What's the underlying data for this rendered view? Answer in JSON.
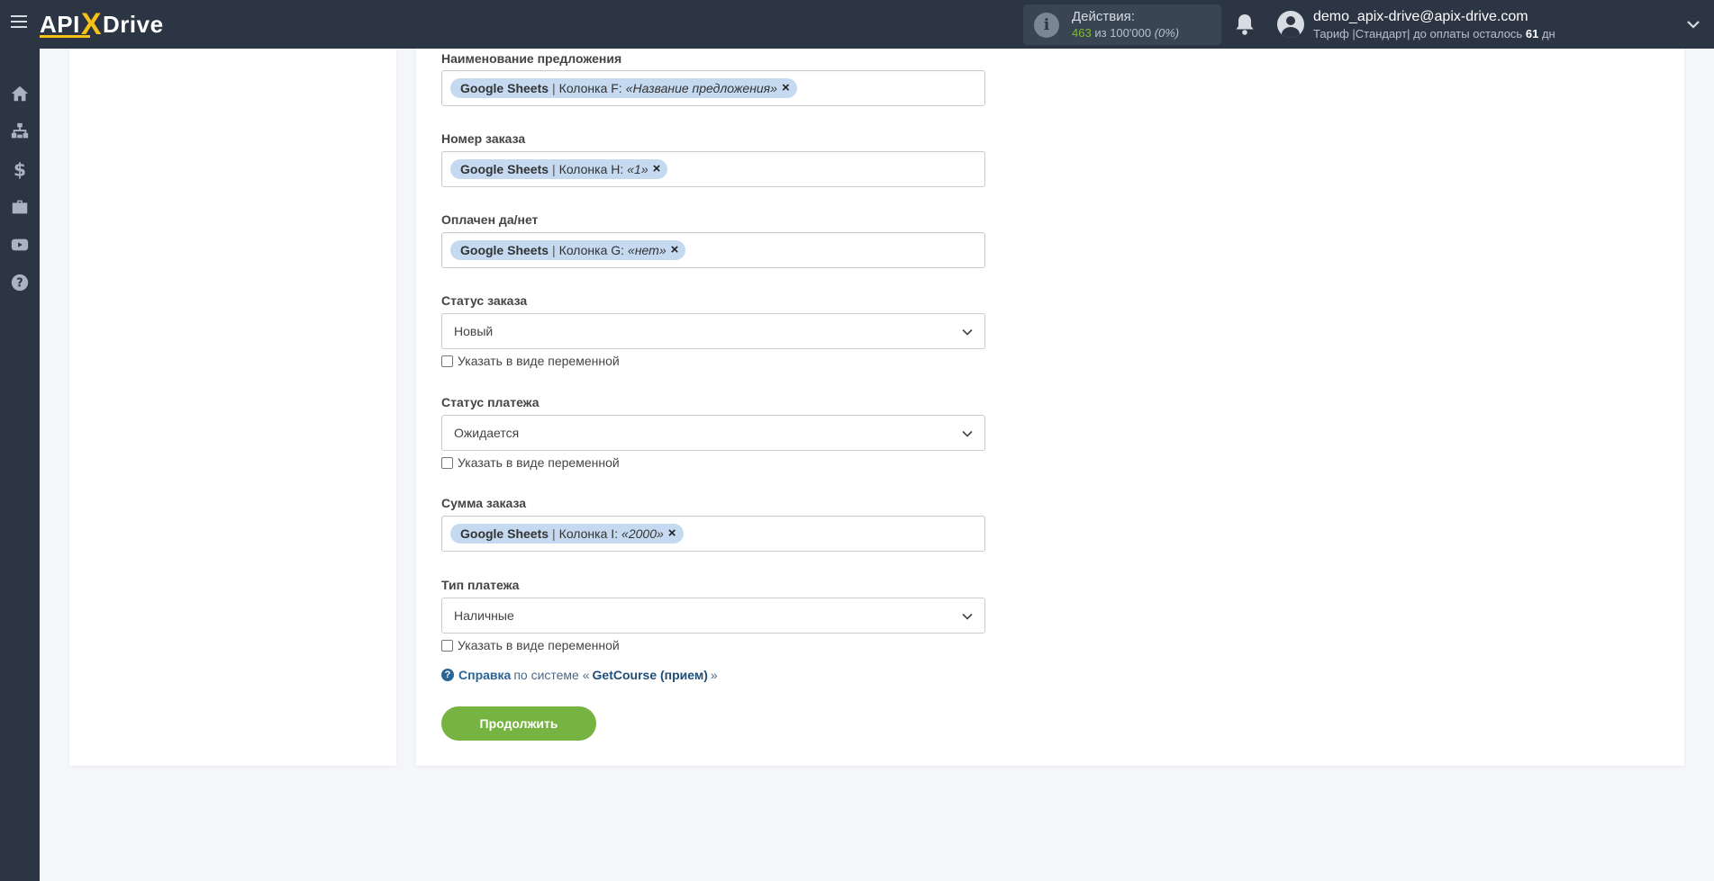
{
  "header": {
    "logo": {
      "part1": "API",
      "part2": "X",
      "part3": "Drive"
    },
    "actions": {
      "label": "Действия:",
      "used": "463",
      "of": "из",
      "total": "100'000",
      "percent": "(0%)"
    },
    "user": {
      "email": "demo_apix-drive@apix-drive.com",
      "plan_prefix": "Тариф |Стандарт| до оплаты осталось",
      "days": "61",
      "days_suffix": "дн"
    }
  },
  "sidebar": {
    "items": [
      {
        "icon": "home-icon"
      },
      {
        "icon": "sitemap-icon"
      },
      {
        "icon": "dollar-icon"
      },
      {
        "icon": "briefcase-icon"
      },
      {
        "icon": "youtube-icon"
      },
      {
        "icon": "help-icon"
      }
    ]
  },
  "form": {
    "offer_name": {
      "label": "Наименование предложения",
      "source": "Google Sheets",
      "column": "Колонка F:",
      "value": "«Название предложения»"
    },
    "order_number": {
      "label": "Номер заказа",
      "source": "Google Sheets",
      "column": "Колонка H:",
      "value": "«1»"
    },
    "paid": {
      "label": "Оплачен да/нет",
      "source": "Google Sheets",
      "column": "Колонка G:",
      "value": "«нет»"
    },
    "order_status": {
      "label": "Статус заказа",
      "value": "Новый",
      "checkbox": "Указать в виде переменной"
    },
    "payment_status": {
      "label": "Статус платежа",
      "value": "Ожидается",
      "checkbox": "Указать в виде переменной"
    },
    "order_sum": {
      "label": "Сумма заказа",
      "source": "Google Sheets",
      "column": "Колонка I:",
      "value": "«2000»"
    },
    "payment_type": {
      "label": "Тип платежа",
      "value": "Наличные",
      "checkbox": "Указать в виде переменной"
    },
    "help": {
      "link": "Справка",
      "text": "по системе «",
      "system": "GetCourse (прием)",
      "close": "»"
    },
    "continue_label": "Продолжить"
  },
  "colors": {
    "topbar": "#2b3543",
    "accent_green": "#77b341",
    "tag_bg": "#c5daf0",
    "link": "#2a6496"
  }
}
